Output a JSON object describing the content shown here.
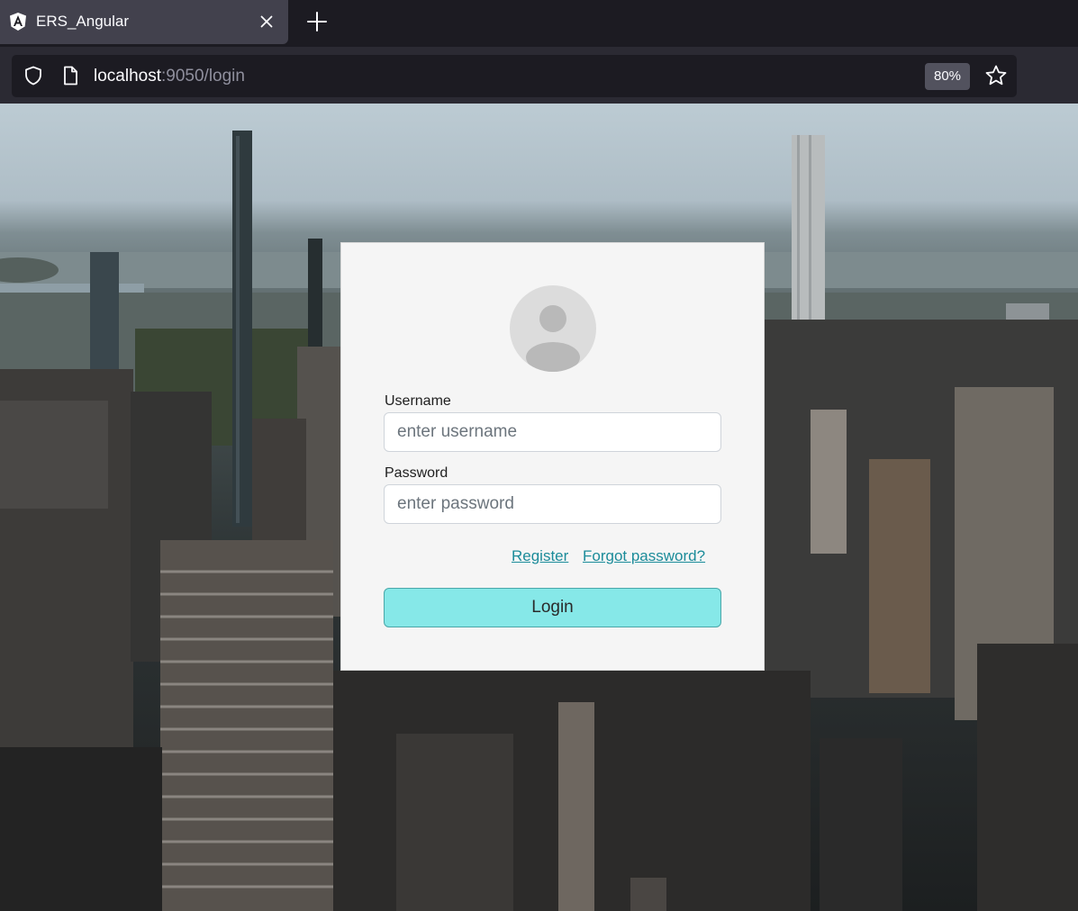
{
  "browser": {
    "tab": {
      "title": "ERS_Angular",
      "favicon": "angular-logo-icon"
    },
    "url": {
      "host": "localhost",
      "rest": ":9050/login"
    },
    "zoom": "80%",
    "icons": [
      "shield-icon",
      "page-icon",
      "star-icon",
      "close-icon",
      "plus-icon"
    ]
  },
  "login": {
    "username_label": "Username",
    "username_placeholder": "enter username",
    "username_value": "",
    "password_label": "Password",
    "password_placeholder": "enter password",
    "password_value": "",
    "register_link": "Register",
    "forgot_link": "Forgot password?",
    "login_button": "Login"
  },
  "colors": {
    "card_background": "#f5f5f5",
    "login_button": "#86e8e8",
    "link": "#1c8c9a",
    "browser_chrome": "#1c1b22"
  }
}
